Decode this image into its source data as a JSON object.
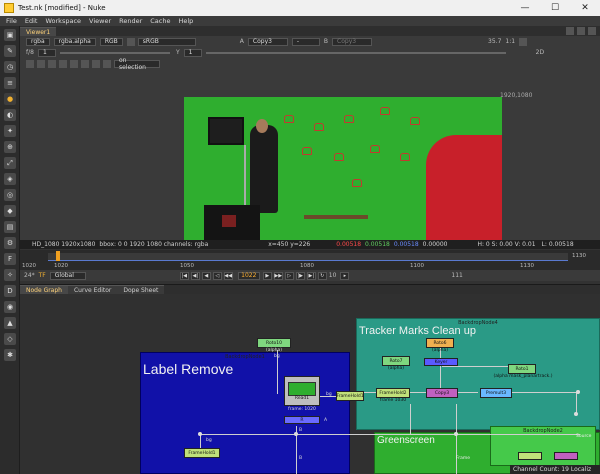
{
  "window": {
    "title": "Test.nk [modified] - Nuke",
    "minimize": "—",
    "maximize": "☐",
    "close": "✕"
  },
  "menu": [
    "File",
    "Edit",
    "Workspace",
    "Viewer",
    "Render",
    "Cache",
    "Help"
  ],
  "viewer": {
    "tab": "Viewer1",
    "channels": "rgba",
    "layer": "rgba.alpha",
    "display_channels": "RGB",
    "colorspace": "sRGB",
    "input_a_label": "A",
    "input_a": "Copy3",
    "op": "-",
    "input_b_label": "B",
    "input_b": "Copy3",
    "zoom": "35.7",
    "ratio": "1:1",
    "view_mode": "2D",
    "fstop": "f/8",
    "gain": "1",
    "gamma_label": "Y",
    "gamma": "1",
    "update_mode": "on selection",
    "resolution": "1920,1080",
    "info": {
      "format": "HD_1080 1920x1080",
      "bbox": "bbox: 0 0 1920 1080 channels: rgba",
      "coords": "x=450 y=226",
      "r": "0.00518",
      "g": "0.00518",
      "b": "0.00518",
      "a": "0.00000",
      "hsv": "H: 0 S: 0.00 V: 0.01",
      "luma": "L: 0.00518"
    }
  },
  "timeline": {
    "start": "1020",
    "ticks": [
      "1020",
      "1050",
      "1080",
      "1100",
      "1130"
    ],
    "end": "1130",
    "fps": "24*",
    "tc_mode": "TF",
    "scope": "Global",
    "current_frame": "1022",
    "step": "10",
    "last_frame": "111"
  },
  "panels": {
    "node_graph": "Node Graph",
    "curve_editor": "Curve Editor",
    "dope_sheet": "Dope Sheet"
  },
  "nodegraph": {
    "backdrop1": {
      "name": "BackdropNode1",
      "label": "Label Remove",
      "color": "#1111a8"
    },
    "backdrop2": {
      "name": "BackdropNode4",
      "label": "Tracker Marks Clean up",
      "color": "#2a9a86"
    },
    "backdrop3": {
      "name": "BackdropNode2",
      "label": "Greenscreen",
      "color": "#2fae2f"
    },
    "nodes": {
      "roto10": "Roto10",
      "roto10_sub": "(alpha)",
      "read1": "Read1",
      "read1_sub": "frame: 1020",
      "framehold1": "FrameHold1",
      "framehold2": "FrameHold2",
      "framehold2_sub": "frame 1030",
      "copy3": "Copy3",
      "roto7": "Roto7",
      "roto7_sub": "(alpha)",
      "roto6": "Roto6",
      "roto6_sub": "(alpha)",
      "roto1": "Roto1",
      "roto1_sub": "(alpha mask_planartrack.)",
      "premult": "Premult3",
      "grain": "Keyer",
      "frame_label": "Frame",
      "source_label": "Source",
      "port_bg": "bg",
      "port_a": "A",
      "port_b": "B",
      "node_r": "R"
    }
  },
  "status": "Channel Count: 19 Localiz"
}
